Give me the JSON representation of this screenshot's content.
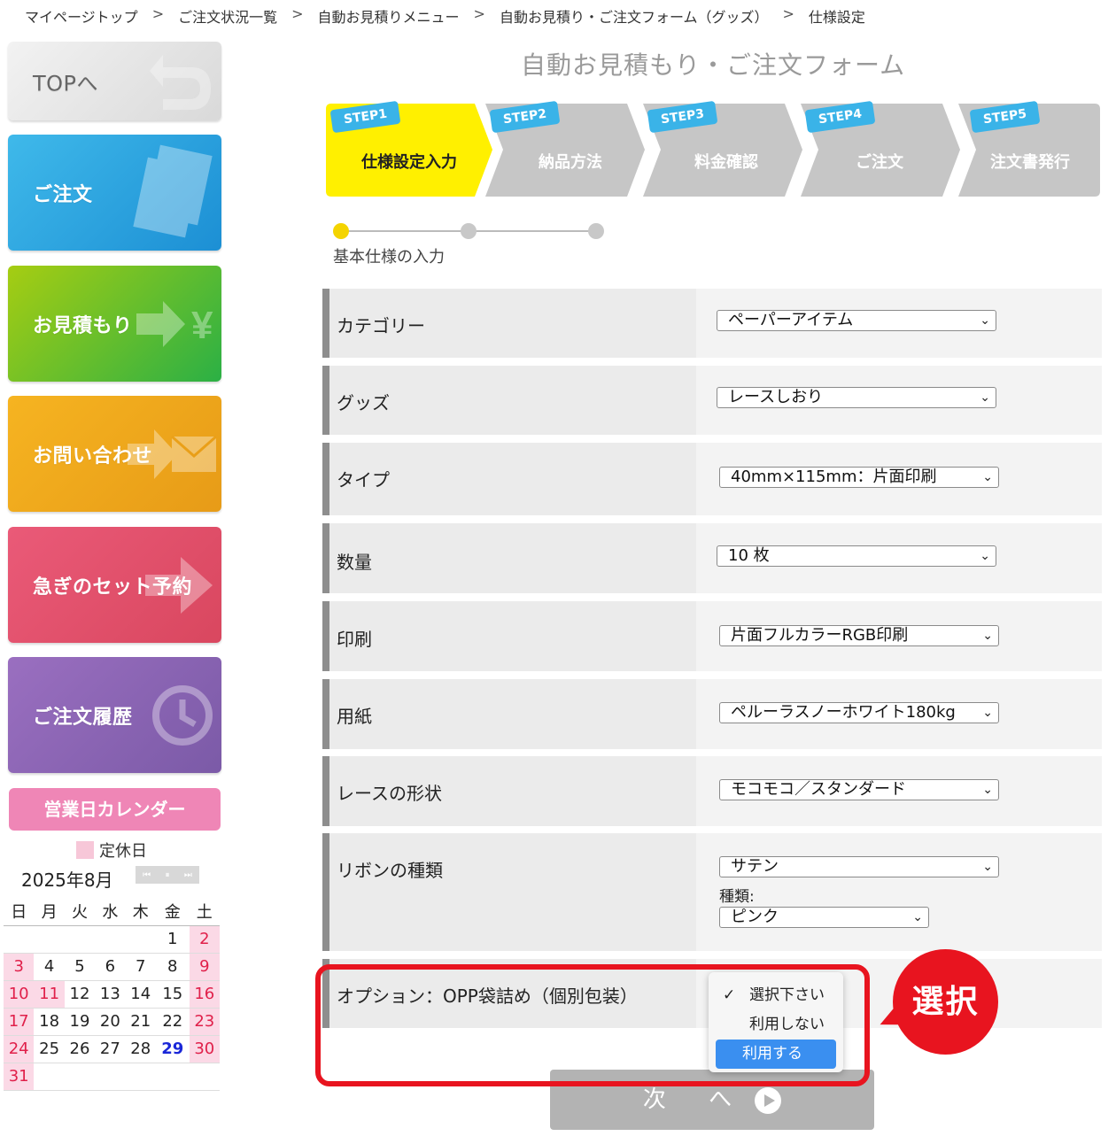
{
  "breadcrumb": {
    "items": [
      "マイページトップ",
      "ご注文状況一覧",
      "自動お見積りメニュー",
      "自動お見積り・ご注文フォーム（グッズ）",
      "仕様設定"
    ],
    "separator": ">"
  },
  "sidebar": {
    "top_label": "TOPへ",
    "order_label": "ご注文",
    "estimate_label": "お見積もり",
    "contact_label": "お問い合わせ",
    "rush_label": "急ぎのセット予約",
    "history_label": "ご注文履歴"
  },
  "calendar": {
    "header": "営業日カレンダー",
    "legend": "定休日",
    "month": "2025年8月",
    "weekdays": [
      "日",
      "月",
      "火",
      "水",
      "木",
      "金",
      "土"
    ],
    "weeks": [
      [
        "",
        "",
        "",
        "",
        "",
        "1",
        "2"
      ],
      [
        "3",
        "4",
        "5",
        "6",
        "7",
        "8",
        "9"
      ],
      [
        "10",
        "11",
        "12",
        "13",
        "14",
        "15",
        "16"
      ],
      [
        "17",
        "18",
        "19",
        "20",
        "21",
        "22",
        "23"
      ],
      [
        "24",
        "25",
        "26",
        "27",
        "28",
        "29",
        "30"
      ],
      [
        "31",
        "",
        "",
        "",
        "",
        "",
        ""
      ]
    ],
    "holiday_color": "#fbd9e6",
    "today_color": "#1a27d8"
  },
  "main": {
    "title": "自動お見積もり・ご注文フォーム",
    "steps": [
      {
        "tag": "STEP1",
        "label": "仕様設定入力",
        "active": true
      },
      {
        "tag": "STEP2",
        "label": "納品方法",
        "active": false
      },
      {
        "tag": "STEP3",
        "label": "料金確認",
        "active": false
      },
      {
        "tag": "STEP4",
        "label": "ご注文",
        "active": false
      },
      {
        "tag": "STEP5",
        "label": "注文書発行",
        "active": false
      }
    ],
    "progress_label": "基本仕様の入力",
    "fields": {
      "category": {
        "label": "カテゴリー",
        "value": "ペーパーアイテム"
      },
      "goods": {
        "label": "グッズ",
        "value": "レースしおり"
      },
      "type": {
        "label": "タイプ",
        "value": "40mm×115mm：片面印刷"
      },
      "quantity": {
        "label": "数量",
        "value": "10 枚"
      },
      "print": {
        "label": "印刷",
        "value": "片面フルカラーRGB印刷"
      },
      "paper": {
        "label": "用紙",
        "value": "ペルーラスノーホワイト180kg"
      },
      "lace_shape": {
        "label": "レースの形状",
        "value": "モコモコ／スタンダード"
      },
      "ribbon": {
        "label": "リボンの種類",
        "value": "サテン",
        "sub_label": "種類:",
        "sub_value": "ピンク"
      },
      "option": {
        "label": "オプション：OPP袋詰め（個別包装）"
      }
    },
    "option_dropdown": {
      "options": [
        "選択下さい",
        "利用しない",
        "利用する"
      ],
      "checked": "選択下さい",
      "highlighted": "利用する",
      "check_mark": "✓"
    },
    "callout": "選択",
    "next_button": "次 へ"
  },
  "colors": {
    "accent_yellow": "#fff000",
    "step_gray": "#c6c6c6",
    "step_tag_blue": "#3ab3e8",
    "highlight_red": "#e8141f",
    "option_highlight_blue": "#3a8ff0"
  }
}
